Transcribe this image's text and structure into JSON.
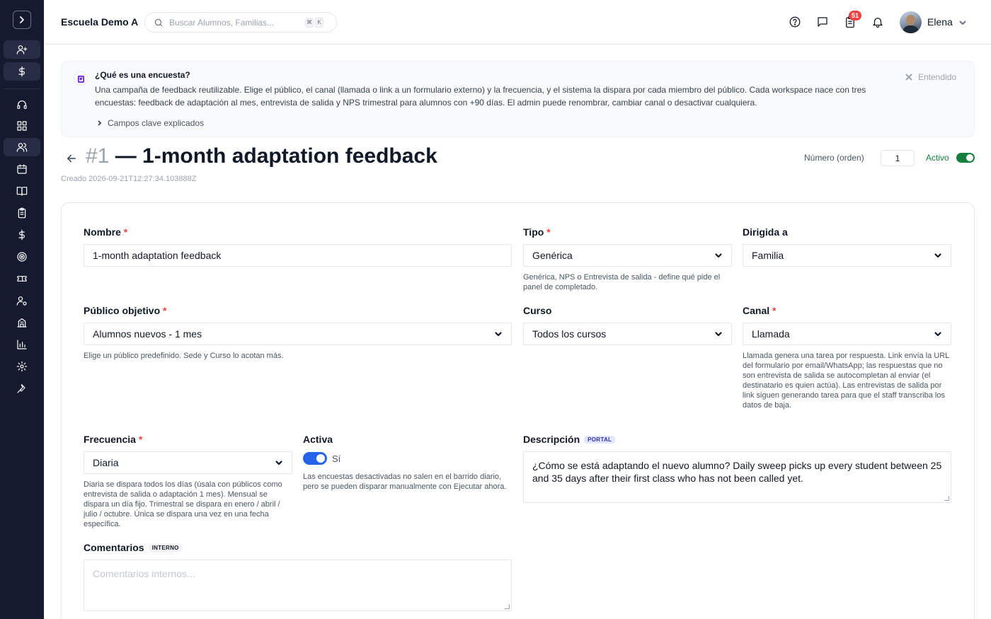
{
  "topbar": {
    "school": "Escuela Demo A",
    "search_placeholder": "Buscar Alumnos, Familias...",
    "shortcut_keys": [
      "⌘",
      "K"
    ],
    "notification_count": "51",
    "user_name": "Elena"
  },
  "sidebar": {
    "icons": [
      "chevron-right-icon",
      "user-plus-icon",
      "dollar-icon",
      "headset-icon",
      "grid-icon",
      "users-icon",
      "calendar-icon",
      "book-icon",
      "clipboard-icon",
      "dollar-icon",
      "target-icon",
      "ticket-icon",
      "user-cog-icon",
      "building-icon",
      "bar-chart-icon",
      "settings-icon",
      "wrench-icon"
    ]
  },
  "info": {
    "title": "¿Qué es una encuesta?",
    "body": "Una campaña de feedback reutilizable. Elige el público, el canal (llamada o link a un formulario externo) y la frecuencia, y el sistema la dispara por cada miembro del público. Cada workspace nace con tres encuestas: feedback de adaptación al mes, entrevista de salida y NPS trimestral para alumnos con +90 días. El admin puede renombrar, cambiar canal o desactivar cualquiera.",
    "link": "Campos clave explicados",
    "dismiss": "Entendido"
  },
  "header": {
    "number": "#1",
    "title": "— 1-month adaptation feedback",
    "created": "Creado 2026-09-21T12:27:34.103888Z",
    "order_label": "Número (orden)",
    "order_value": "1",
    "active_label": "Activo"
  },
  "form": {
    "nombre": {
      "label": "Nombre",
      "required": "*",
      "value": "1-month adaptation feedback"
    },
    "tipo": {
      "label": "Tipo",
      "required": "*",
      "value": "Genérica",
      "hint": "Genérica, NPS o Entrevista de salida - define qué pide el panel de completado."
    },
    "dirigida": {
      "label": "Dirigida a",
      "value": "Familia"
    },
    "publico": {
      "label": "Público objetivo",
      "required": "*",
      "value": "Alumnos nuevos - 1 mes",
      "hint": "Elige un público predefinido. Sede y Curso lo acotan más."
    },
    "curso": {
      "label": "Curso",
      "value": "Todos los cursos"
    },
    "canal": {
      "label": "Canal",
      "required": "*",
      "value": "Llamada",
      "hint": "Llamada genera una tarea por respuesta. Link envía la URL del formulario por email/WhatsApp; las respuestas que no son entrevista de salida se autocompletan al enviar (el destinatario es quien actúa). Las entrevistas de salida por link siguen generando tarea para que el staff transcriba los datos de baja."
    },
    "frecuencia": {
      "label": "Frecuencia",
      "required": "*",
      "value": "Diaria",
      "hint": "Diaria se dispara todos los días (úsala con públicos como entrevista de salida o adaptación 1 mes). Mensual se dispara un día fijo. Trimestral se dispara en enero / abril / julio / octubre. Única se dispara una vez en una fecha específica."
    },
    "activa": {
      "label": "Activa",
      "toggle_text": "Sí",
      "hint": "Las encuestas desactivadas no salen en el barrido diario, pero se pueden disparar manualmente con Ejecutar ahora."
    },
    "descripcion": {
      "label": "Descripción",
      "tag": "PORTAL",
      "value": "¿Cómo se está adaptando el nuevo alumno? Daily sweep picks up every student between 25 and 35 days after their first class who has not been called yet."
    },
    "comentarios": {
      "label": "Comentarios",
      "tag": "INTERNO",
      "placeholder": "Comentarios internos..."
    }
  }
}
